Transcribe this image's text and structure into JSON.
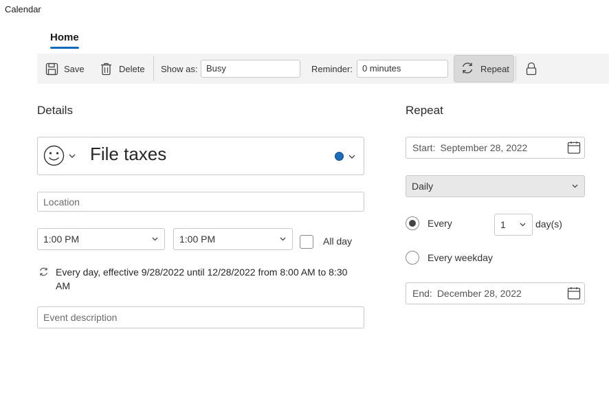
{
  "app": {
    "title": "Calendar"
  },
  "tabs": {
    "home": "Home"
  },
  "toolbar": {
    "save_label": "Save",
    "delete_label": "Delete",
    "show_as_label": "Show as:",
    "show_as_value": "Busy",
    "reminder_label": "Reminder:",
    "reminder_value": "0 minutes",
    "repeat_label": "Repeat",
    "icons": [
      "save-icon",
      "trash-icon",
      "repeat-icon",
      "lock-icon"
    ]
  },
  "details": {
    "heading": "Details",
    "emoji_icon": "smiley-icon",
    "event_title": "File taxes",
    "category_color": "#1c6cb8",
    "location_placeholder": "Location",
    "start_time": "1:00 PM",
    "end_time": "1:00 PM",
    "all_day_label": "All day",
    "all_day_checked": false,
    "recurrence_summary": "Every day, effective 9/28/2022 until 12/28/2022 from 8:00 AM to 8:30 AM",
    "description_placeholder": "Event description"
  },
  "repeat": {
    "heading": "Repeat",
    "start_label": "Start:",
    "start_value": "September 28, 2022",
    "frequency": "Daily",
    "every_label": "Every",
    "every_value": "1",
    "every_unit": "day(s)",
    "every_weekday_label": "Every weekday",
    "selected_option": "every",
    "end_label": "End:",
    "end_value": "December 28, 2022"
  },
  "colors": {
    "accent": "#0f6cbd",
    "toolbar_bg": "#f3f3f3",
    "active_button_bg": "#d9d9d9"
  }
}
